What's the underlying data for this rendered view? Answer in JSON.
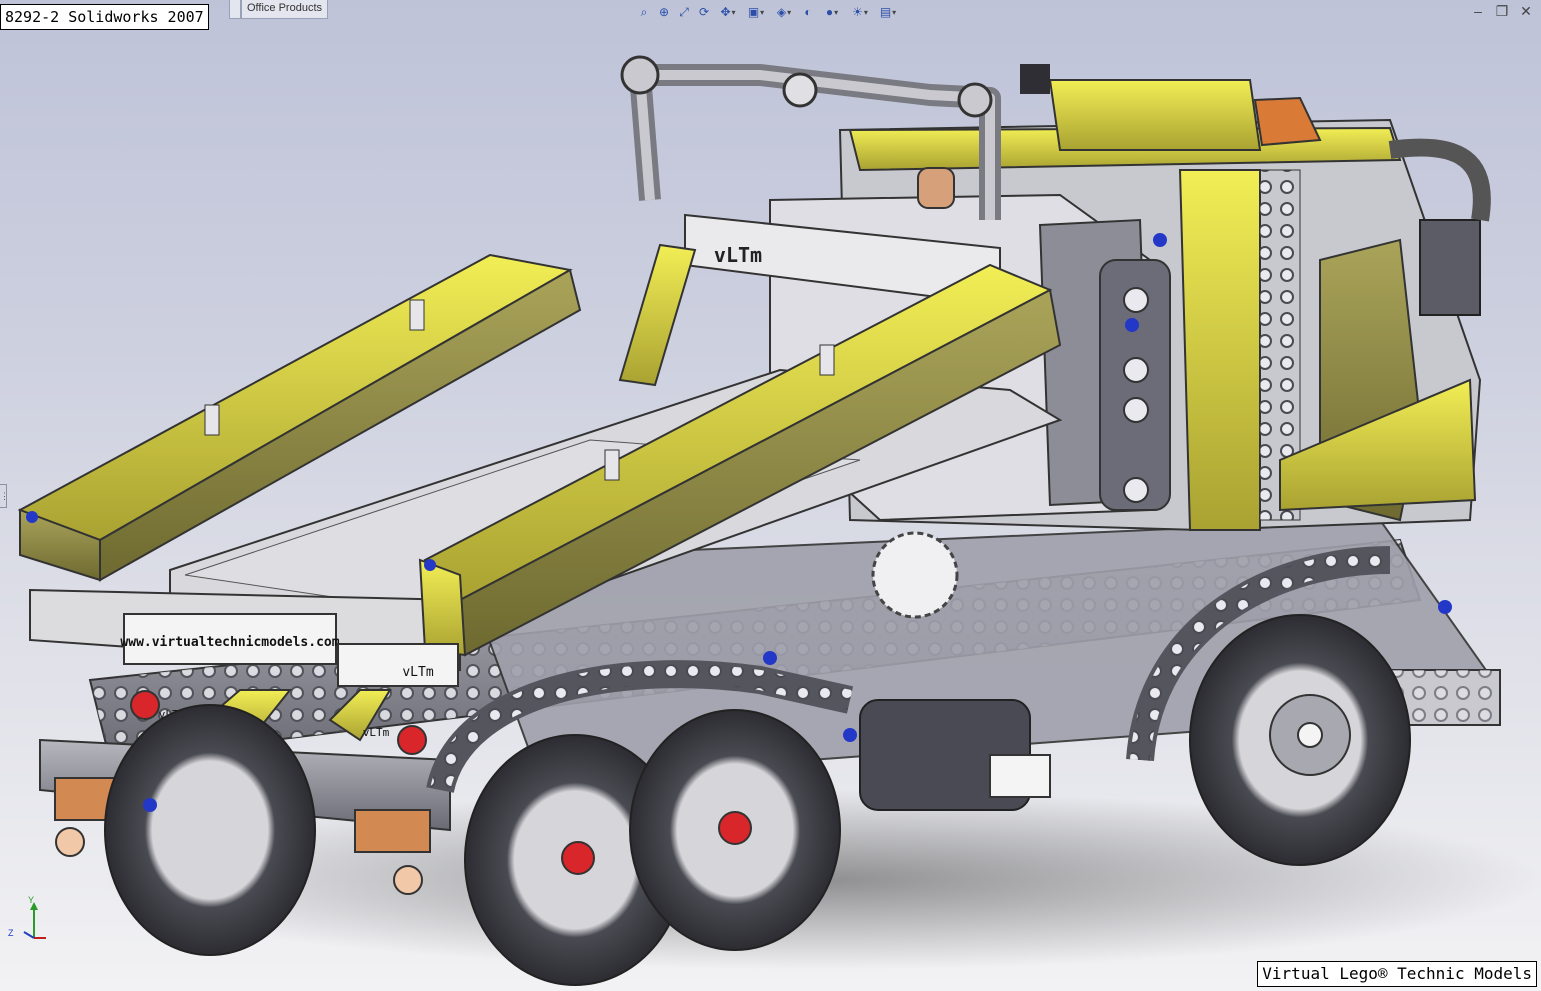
{
  "window": {
    "title_caption": "8292-2 Solidworks 2007",
    "footer_caption": "Virtual Lego® Technic Models",
    "tabs": [
      {
        "label": ""
      },
      {
        "label": "Office Products"
      }
    ]
  },
  "toolbar": {
    "icons": [
      "zoom-fit-icon",
      "zoom-area-icon",
      "zoom-in-out-icon",
      "rotate-icon",
      "pan-icon",
      "view-orientation-icon",
      "display-style-icon",
      "hide-show-icon",
      "edit-appearance-icon",
      "apply-scene-icon",
      "view-settings-icon"
    ]
  },
  "model": {
    "stickers": {
      "front_panel": "vLTm",
      "website": "www.virtualtechnicmodels.com",
      "bumper_left": "vLTm",
      "bumper_right": "vLTm",
      "bumper_sign": "vLTm"
    }
  },
  "triad": {
    "y_label": "Y",
    "z_label": "Z"
  },
  "colors": {
    "lego_yellow": "#e8e23a",
    "lego_olive": "#8f8a2c",
    "lego_grey": "#8d8d95",
    "lego_dark": "#3e3e46",
    "lego_light": "#dcdcdc",
    "lego_red": "#d8262a",
    "lego_blue": "#2438c8",
    "lego_tan": "#d1874d",
    "background_top": "#bfc3d8",
    "background_bottom": "#f2f2f4"
  }
}
